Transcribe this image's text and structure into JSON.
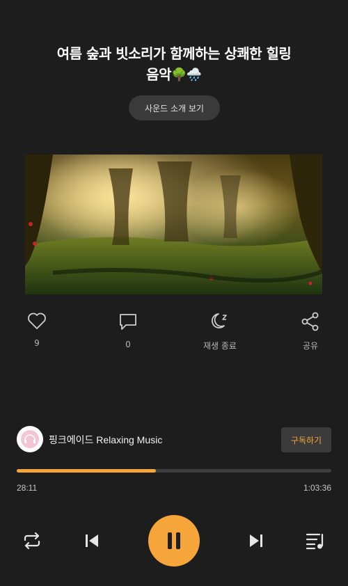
{
  "track": {
    "title_line1": "여름 숲과 빗소리가 함께하는 상쾌한 힐링",
    "title_line2": "음악",
    "title_emoji": "🌳🌧️"
  },
  "sound_intro_button": "사운드 소개 보기",
  "actions": {
    "like": {
      "icon": "heart-icon",
      "label": "9"
    },
    "comment": {
      "icon": "comment-icon",
      "label": "0"
    },
    "sleep_timer": {
      "icon": "moon-sleep-icon",
      "label": "재생 종료"
    },
    "share": {
      "icon": "share-icon",
      "label": "공유"
    }
  },
  "channel": {
    "name": "핑크에이드 Relaxing Music",
    "subscribe_label": "구독하기",
    "avatar_text": "Pink Aid"
  },
  "player": {
    "current_time": "28:11",
    "total_time": "1:03:36",
    "progress_fraction": 0.443,
    "state": "playing"
  },
  "colors": {
    "accent": "#f6a53a",
    "background": "#1d1d1d"
  }
}
